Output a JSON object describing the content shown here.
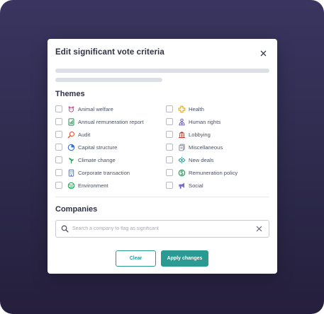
{
  "modal": {
    "title": "Edit significant vote criteria"
  },
  "themes": {
    "heading": "Themes",
    "left": [
      {
        "label": "Animal welfare",
        "icon": "animal-welfare-icon",
        "color": "#d14b9b"
      },
      {
        "label": "Annual remuneration report",
        "icon": "report-icon",
        "color": "#2e8b57"
      },
      {
        "label": "Audit",
        "icon": "audit-icon",
        "color": "#d9583a"
      },
      {
        "label": "Capital structure",
        "icon": "pie-chart-icon",
        "color": "#3a6fcf"
      },
      {
        "label": "Climate change",
        "icon": "climate-icon",
        "color": "#2ea25a"
      },
      {
        "label": "Corporate transaction",
        "icon": "building-icon",
        "color": "#4a7bd0"
      },
      {
        "label": "Environment",
        "icon": "environment-icon",
        "color": "#2ea25a"
      }
    ],
    "right": [
      {
        "label": "Health",
        "icon": "health-icon",
        "color": "#e0a520"
      },
      {
        "label": "Human rights",
        "icon": "human-rights-icon",
        "color": "#6a5acd"
      },
      {
        "label": "Lobbying",
        "icon": "lobbying-icon",
        "color": "#c9302c"
      },
      {
        "label": "Miscellaneous",
        "icon": "misc-icon",
        "color": "#8a8f99"
      },
      {
        "label": "New deals",
        "icon": "new-deals-icon",
        "color": "#2a9a92"
      },
      {
        "label": "Remuneration policy",
        "icon": "remuneration-icon",
        "color": "#2e8b57"
      },
      {
        "label": "Social",
        "icon": "social-icon",
        "color": "#6a5acd"
      }
    ]
  },
  "companies": {
    "heading": "Companies",
    "search_placeholder": "Search a company to flag as significant",
    "search_value": ""
  },
  "actions": {
    "clear_label": "Clear",
    "apply_label": "Apply changes"
  },
  "colors": {
    "accent": "#2a9a92",
    "backdrop": "#2e2a4c",
    "heading": "#2f3146"
  }
}
